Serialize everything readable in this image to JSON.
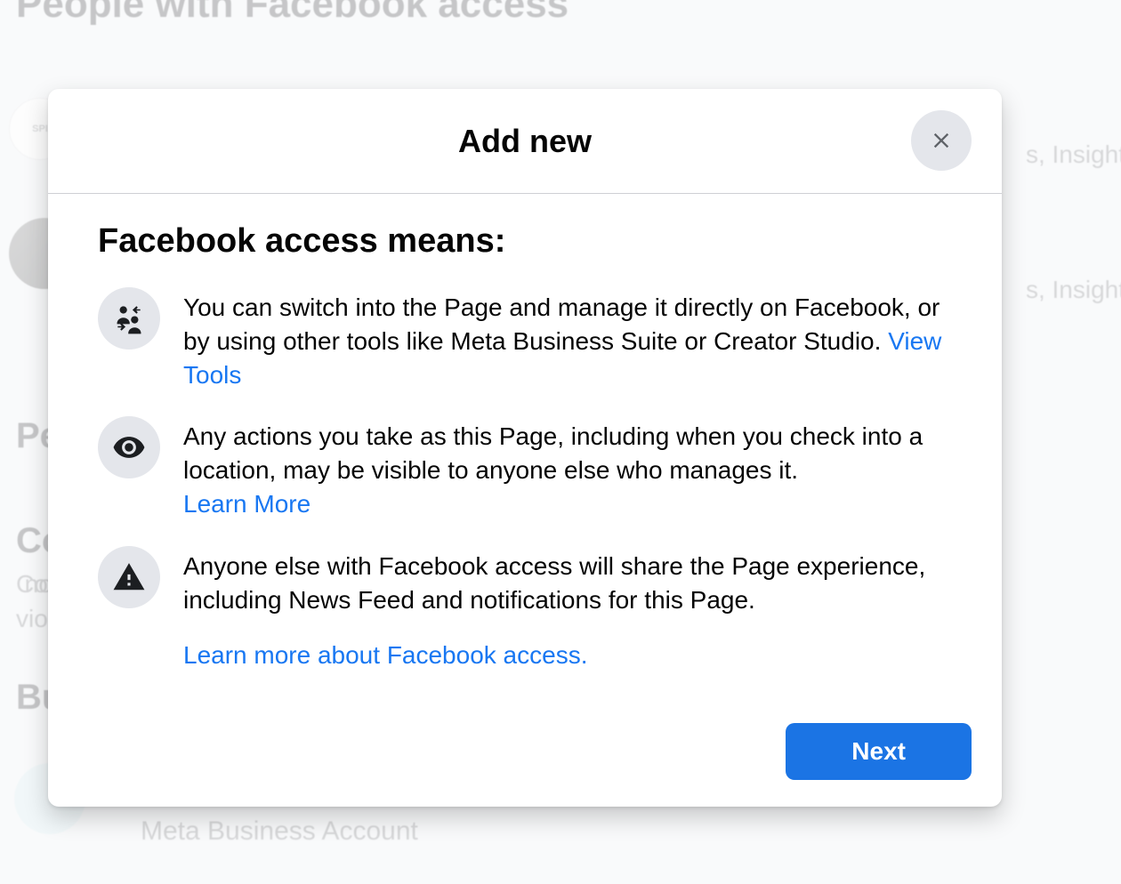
{
  "background": {
    "heading_top": "People with Facebook access",
    "avatar_1_text": "SPI",
    "insight_text": "s, Insight",
    "heading_pe": "Pe",
    "heading_co": "Co",
    "text_co_line1": "Co",
    "text_co_line2": "vio",
    "text_no": "no",
    "heading_bu": "Bu",
    "meta_account": "Meta Business Account"
  },
  "modal": {
    "title": "Add new",
    "heading": "Facebook access means:",
    "items": [
      {
        "text": "You can switch into the Page and manage it directly on Facebook, or by using other tools like Meta Business Suite or Creator Studio. ",
        "link": "View Tools"
      },
      {
        "text": "Any actions you take as this Page, including when you check into a location, may be visible to anyone else who manages it. ",
        "link": "Learn More"
      },
      {
        "text": "Anyone else with Facebook access will share the Page experience, including News Feed and notifications for this Page.",
        "link": ""
      }
    ],
    "learn_more_access": "Learn more about Facebook access.",
    "next_button": "Next"
  }
}
